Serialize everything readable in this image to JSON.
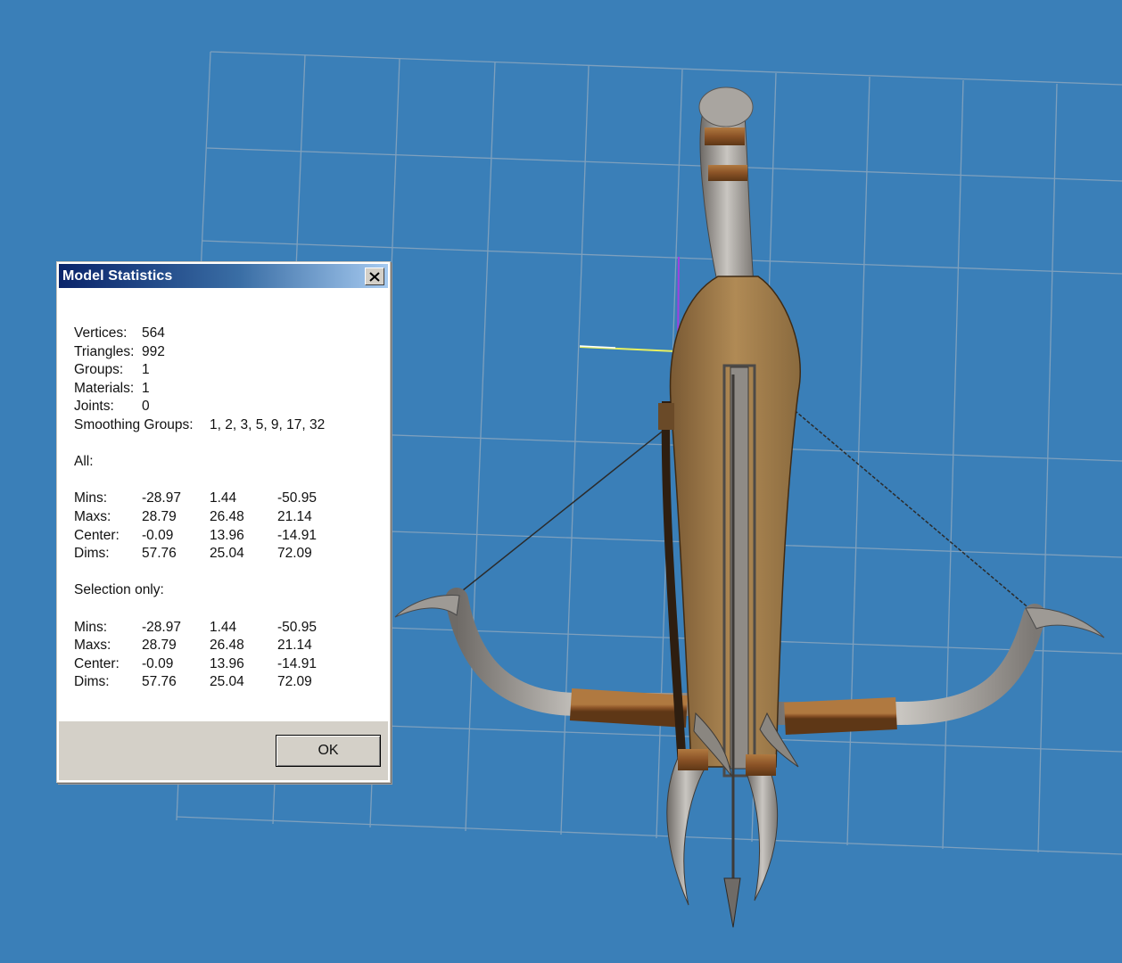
{
  "dialog": {
    "title": "Model Statistics",
    "stats": {
      "vertices_label": "Vertices:",
      "vertices": "564",
      "triangles_label": "Triangles:",
      "triangles": "992",
      "groups_label": "Groups:",
      "groups": "1",
      "materials_label": "Materials:",
      "materials": "1",
      "joints_label": "Joints:",
      "joints": "0",
      "smoothing_label": "Smoothing Groups:",
      "smoothing": "1, 2, 3, 5, 9, 17, 32"
    },
    "all": {
      "heading": "All:",
      "rows": [
        {
          "label": "Mins:",
          "x": "-28.97",
          "y": "1.44",
          "z": "-50.95"
        },
        {
          "label": "Maxs:",
          "x": "28.79",
          "y": "26.48",
          "z": "21.14"
        },
        {
          "label": "Center:",
          "x": "-0.09",
          "y": "13.96",
          "z": "-14.91"
        },
        {
          "label": "Dims:",
          "x": "57.76",
          "y": "25.04",
          "z": "72.09"
        }
      ]
    },
    "selection": {
      "heading": "Selection only:",
      "rows": [
        {
          "label": "Mins:",
          "x": "-28.97",
          "y": "1.44",
          "z": "-50.95"
        },
        {
          "label": "Maxs:",
          "x": "28.79",
          "y": "26.48",
          "z": "21.14"
        },
        {
          "label": "Center:",
          "x": "-0.09",
          "y": "13.96",
          "z": "-14.91"
        },
        {
          "label": "Dims:",
          "x": "57.76",
          "y": "25.04",
          "z": "72.09"
        }
      ]
    },
    "ok_label": "OK"
  },
  "icons": {
    "close": "close-icon"
  },
  "colors": {
    "viewport_bg": "#3a7fb8",
    "grid": "#8aa6bf",
    "wood": "#a8834f",
    "metal": "#a7a39d",
    "wrap": "#9a5e2c"
  }
}
